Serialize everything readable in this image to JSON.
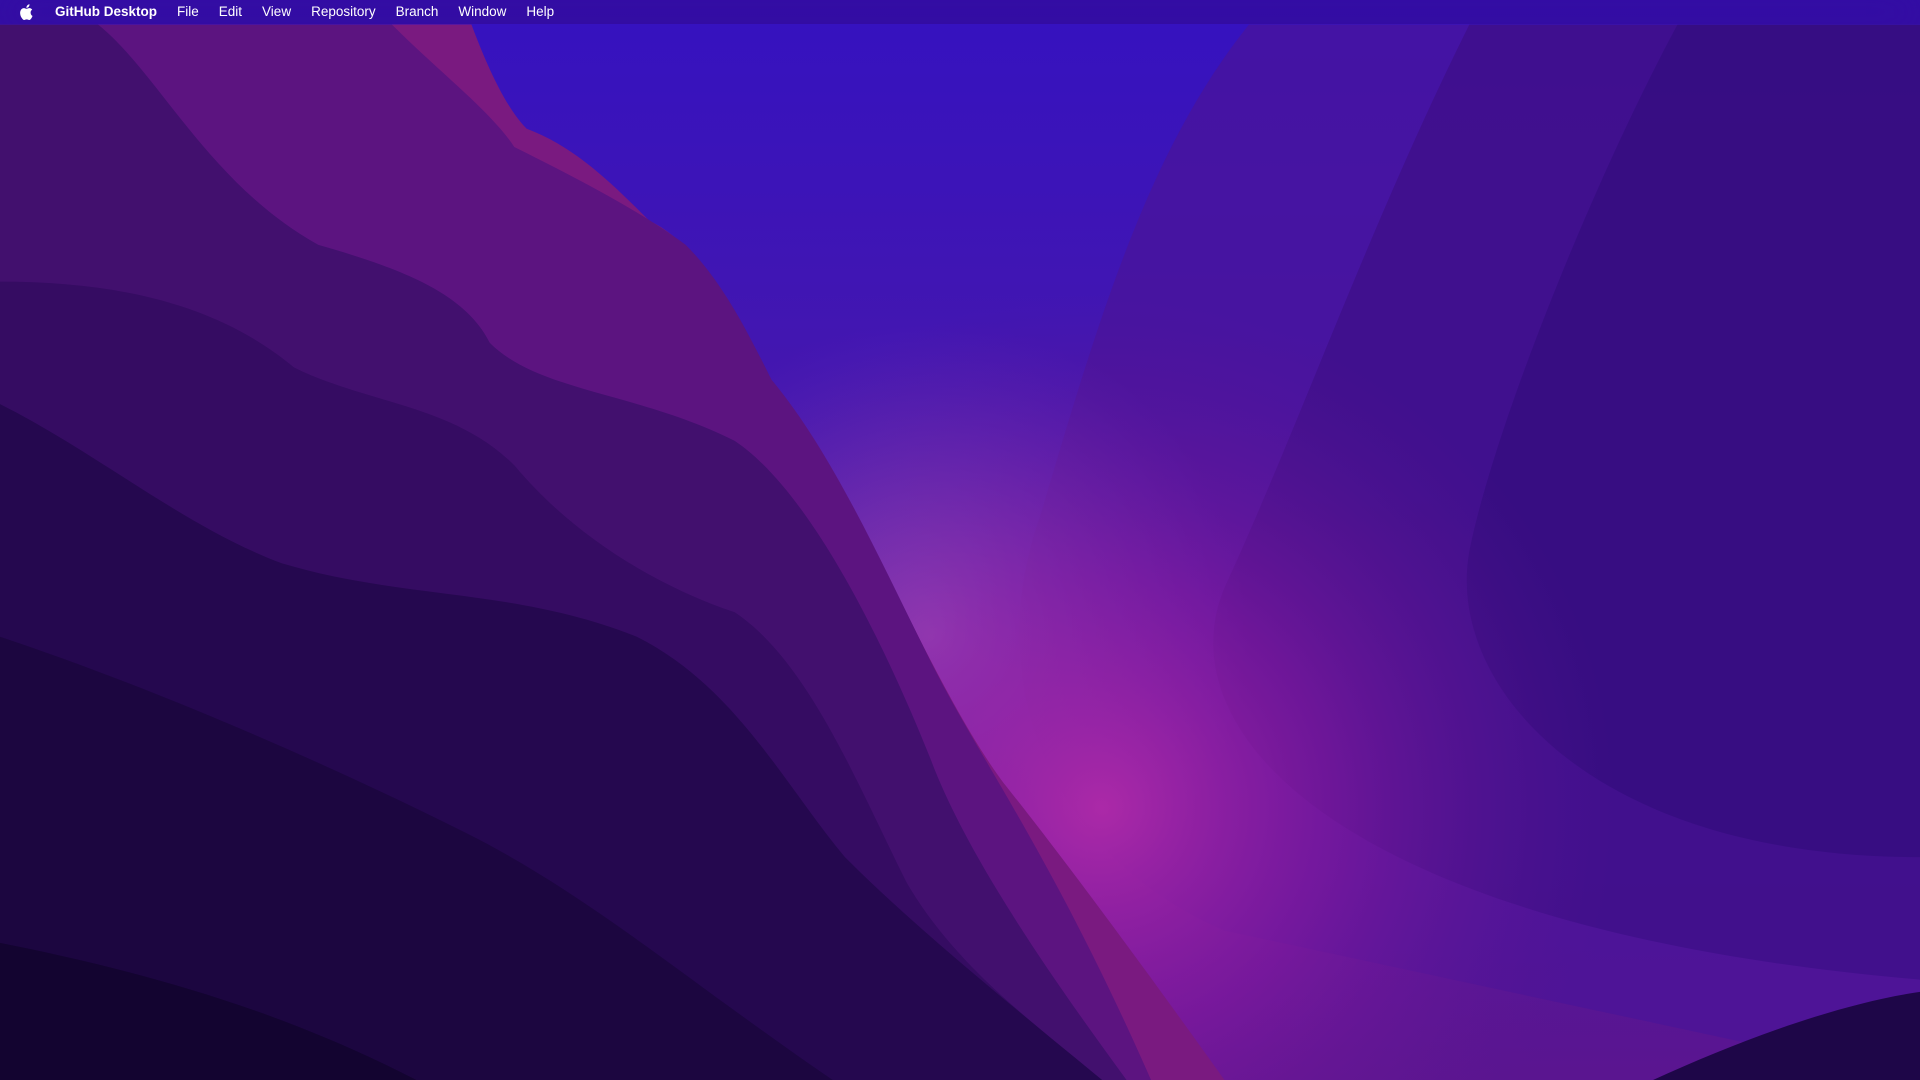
{
  "menubar": {
    "apple_icon": "apple-logo-icon",
    "app_name": "GitHub Desktop",
    "items": [
      "File",
      "Edit",
      "View",
      "Repository",
      "Branch",
      "Window",
      "Help"
    ]
  },
  "colors": {
    "sky_top": "#3a12c8",
    "glow": "#a21ea8",
    "dark": "#140630"
  }
}
